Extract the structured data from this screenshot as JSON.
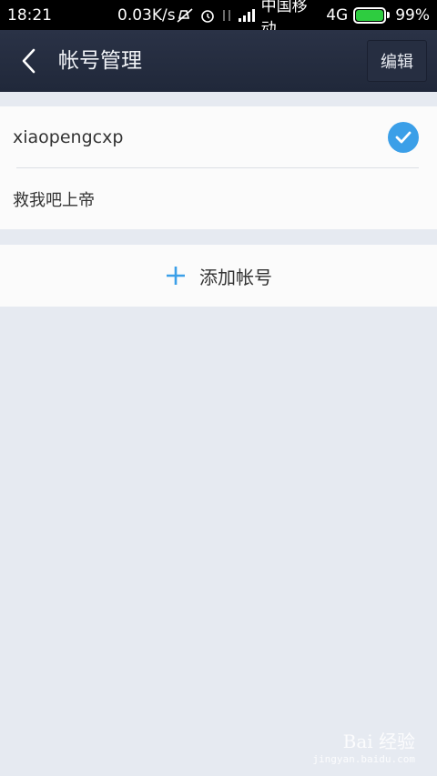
{
  "status_bar": {
    "time": "18:21",
    "speed": "0.03K/s",
    "carrier": "中国移动",
    "network": "4G",
    "battery": "99%",
    "icons": [
      "mute-icon",
      "alarm-icon",
      "data-arrows-icon",
      "signal-icon",
      "battery-icon"
    ]
  },
  "app_bar": {
    "title": "帐号管理",
    "edit_label": "编辑",
    "back_icon": "chevron-left-icon"
  },
  "accounts": [
    {
      "name": "xiaopengcxp",
      "selected": true
    },
    {
      "name": "救我吧上帝",
      "selected": false
    }
  ],
  "add_account": {
    "label": "添加帐号",
    "icon": "plus-icon"
  },
  "watermark": {
    "text": "Bai 经验",
    "sub": "jingyan.baidu.com"
  },
  "colors": {
    "accent": "#3b9fe8",
    "app_bar": "#262e41",
    "background": "#e6eaf1"
  }
}
